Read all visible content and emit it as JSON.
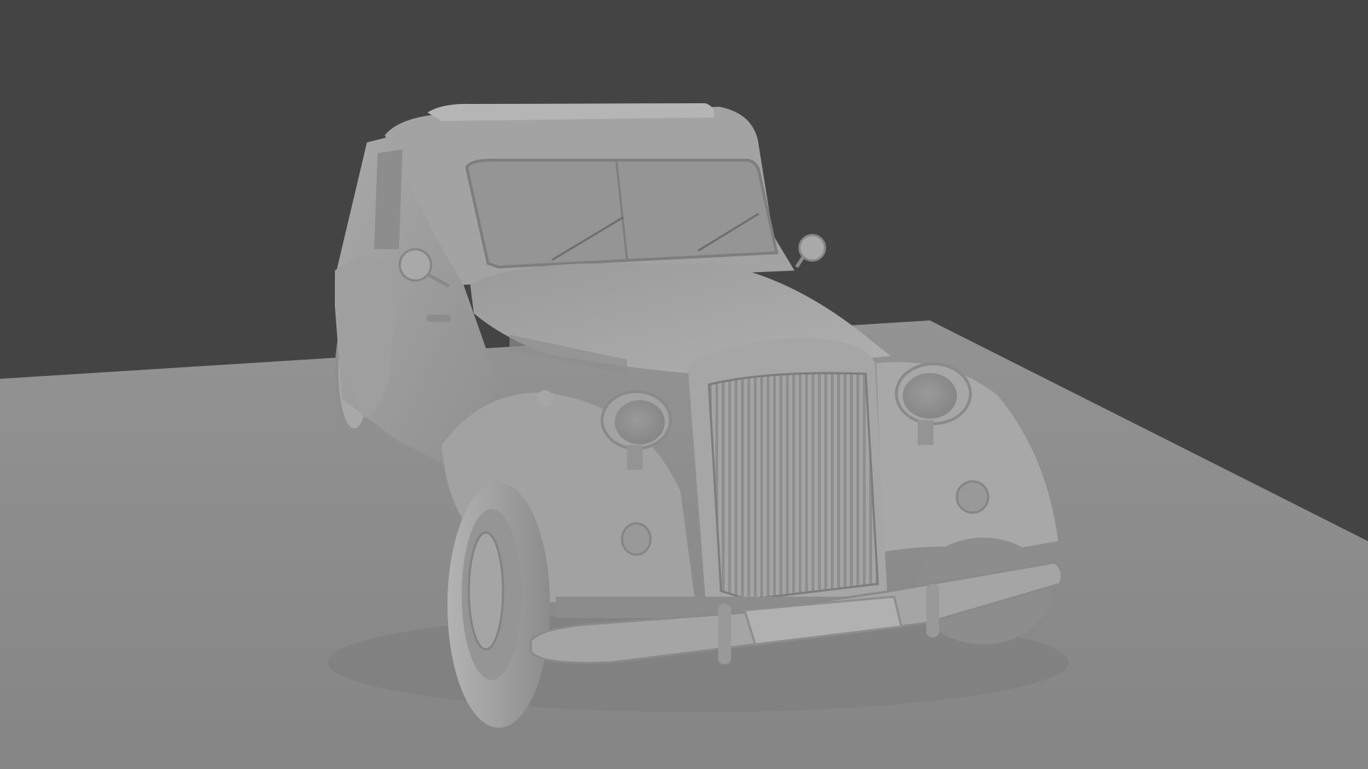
{
  "scene": {
    "background_color": "#444444",
    "floor_color": "#8a8a8a",
    "model_color": "#9c9c9c",
    "model_shadow_color": "#6e6e6e",
    "model_highlight_color": "#b8b8b8",
    "subject": "vintage-car-clay-render"
  }
}
